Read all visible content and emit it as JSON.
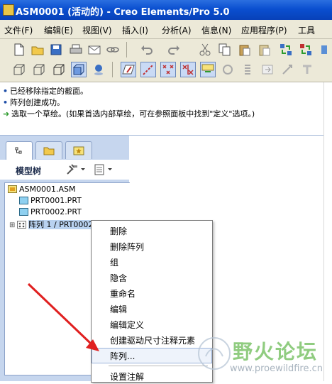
{
  "window": {
    "title": "ASM0001 (活动的) - Creo Elements/Pro 5.0"
  },
  "menubar": {
    "items": [
      {
        "label": "文件(F)"
      },
      {
        "label": "编辑(E)"
      },
      {
        "label": "视图(V)"
      },
      {
        "label": "插入(I)"
      },
      {
        "label": "分析(A)"
      },
      {
        "label": "信息(N)"
      },
      {
        "label": "应用程序(P)"
      },
      {
        "label": "工具"
      }
    ]
  },
  "messages": {
    "lines": [
      {
        "text": "已经移除指定的截面。"
      },
      {
        "text": "阵列创建成功。"
      },
      {
        "text": "选取一个草绘。(如果首选内部草绘，可在参照面板中找到\"定义\"选项。)"
      }
    ]
  },
  "navigator": {
    "title": "模型树",
    "tree": [
      {
        "label": "ASM0001.ASM"
      },
      {
        "label": "PRT0001.PRT"
      },
      {
        "label": "PRT0002.PRT"
      },
      {
        "label": "阵列 1 / PRT0002.PRT"
      }
    ]
  },
  "context_menu": {
    "items": [
      {
        "label": "删除"
      },
      {
        "label": "删除阵列"
      },
      {
        "label": "组"
      },
      {
        "label": "隐含"
      },
      {
        "label": "重命名"
      },
      {
        "label": "编辑"
      },
      {
        "label": "编辑定义"
      },
      {
        "label": "创建驱动尺寸注释元素"
      },
      {
        "label": "阵列..."
      },
      {
        "label": "设置注解"
      }
    ]
  },
  "watermark": {
    "name": "野火论坛",
    "url": "www.proewildfire.cn"
  },
  "colors": {
    "titlebar": "#0a4fd0",
    "navigator_bg": "#c6d6ee",
    "annotation_arrow": "#e02020"
  }
}
